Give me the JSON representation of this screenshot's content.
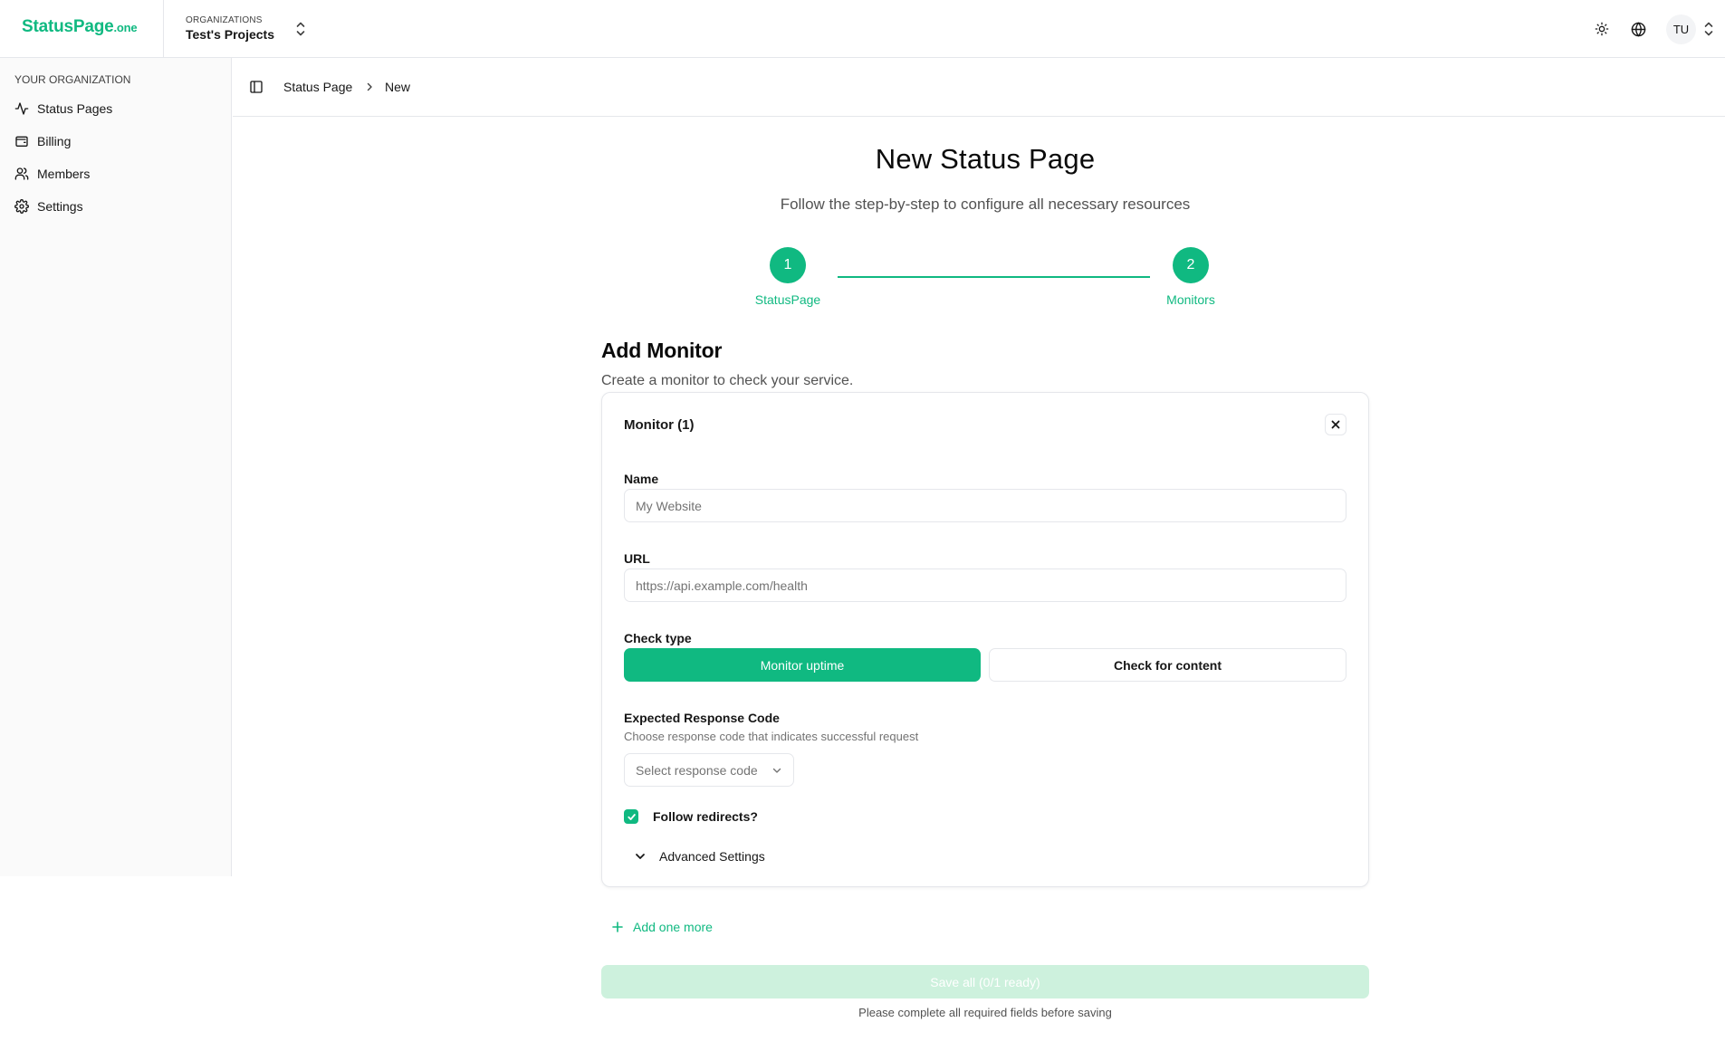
{
  "header": {
    "logo_main": "StatusPage",
    "logo_suffix": ".one",
    "org_caption": "ORGANIZATIONS",
    "org_name": "Test's Projects",
    "user_initials": "TU"
  },
  "sidebar": {
    "caption": "YOUR ORGANIZATION",
    "items": [
      {
        "label": "Status Pages",
        "icon": "activity-icon"
      },
      {
        "label": "Billing",
        "icon": "wallet-icon"
      },
      {
        "label": "Members",
        "icon": "users-icon"
      },
      {
        "label": "Settings",
        "icon": "gear-icon"
      }
    ]
  },
  "breadcrumb": {
    "items": [
      "Status Page",
      "New"
    ]
  },
  "page": {
    "title": "New Status Page",
    "subtitle": "Follow the step-by-step to configure all necessary resources"
  },
  "stepper": {
    "steps": [
      {
        "number": "1",
        "label": "StatusPage"
      },
      {
        "number": "2",
        "label": "Monitors"
      }
    ]
  },
  "section": {
    "title": "Add Monitor",
    "subtitle": "Create a monitor to check your service."
  },
  "monitor_card": {
    "title": "Monitor (1)",
    "name_label": "Name",
    "name_placeholder": "My Website",
    "name_value": "",
    "url_label": "URL",
    "url_placeholder": "https://api.example.com/health",
    "url_value": "",
    "check_type_label": "Check type",
    "check_type_options": [
      "Monitor uptime",
      "Check for content"
    ],
    "check_type_selected": "Monitor uptime",
    "response_code_label": "Expected Response Code",
    "response_code_help": "Choose response code that indicates successful request",
    "response_code_placeholder": "Select response code",
    "follow_redirects_label": "Follow redirects?",
    "follow_redirects_checked": true,
    "advanced_label": "Advanced Settings"
  },
  "actions": {
    "add_more_label": "Add one more",
    "save_label": "Save all (0/1 ready)",
    "save_note": "Please complete all required fields before saving"
  },
  "colors": {
    "brand": "#10b981",
    "save_disabled_bg": "#cdf1dd",
    "border": "#e5e7eb",
    "sidebar_bg": "#fafafa"
  }
}
